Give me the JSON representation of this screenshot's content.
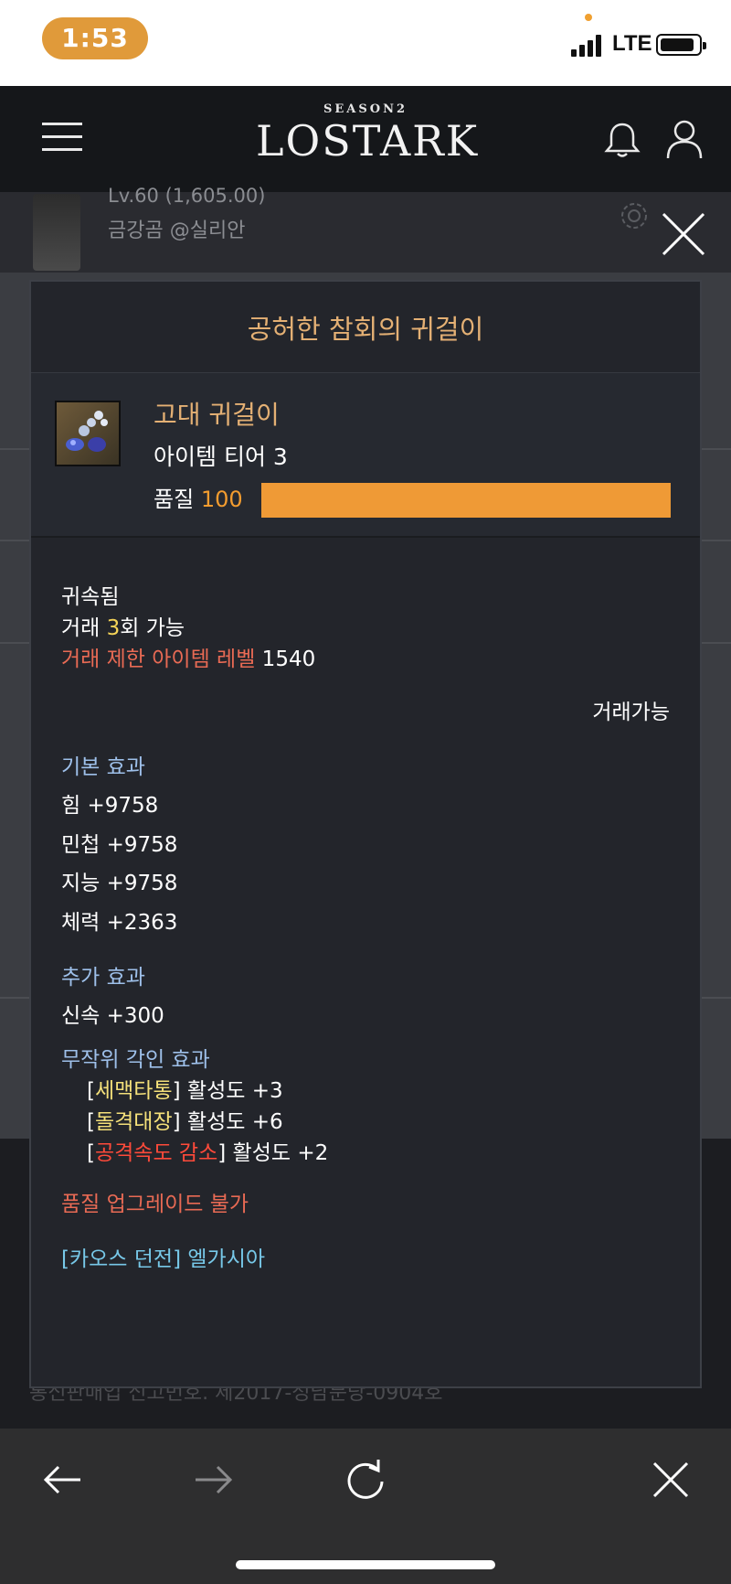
{
  "status_bar": {
    "time": "1:53",
    "network": "LTE"
  },
  "header": {
    "logo_season": "SEASON2",
    "logo_main": "LOSTARK"
  },
  "character": {
    "level": "Lv.60 (1,605.00)",
    "name": "금강곰 @실리안"
  },
  "footer": {
    "registration": "통신판매업 신고번호. 제2017-성남분당-0904호"
  },
  "tooltip": {
    "title": "공허한 참회의 귀걸이",
    "grade": "고대 귀걸이",
    "tier": "아이템 티어 3",
    "quality_label": "품질",
    "quality_value": "100",
    "quality_percent": 100,
    "bound": "귀속됨",
    "trade_prefix": "거래 ",
    "trade_count": "3",
    "trade_suffix": "회 가능",
    "trade_limit_label": "거래 제한 아이템 레벨",
    "trade_limit_value": " 1540",
    "tradeable": "거래가능",
    "basic_effect_title": "기본 효과",
    "basic_effects": [
      "힘 +9758",
      "민첩 +9758",
      "지능 +9758",
      "체력 +2363"
    ],
    "extra_effect_title": "추가 효과",
    "extra_effects": [
      "신속 +300"
    ],
    "engraving_title": "무작위 각인 효과",
    "engravings": [
      {
        "open": "[",
        "name": "세맥타통",
        "close": "]",
        "activity": " 활성도 +3"
      },
      {
        "open": "[",
        "name": "돌격대장",
        "close": "]",
        "activity": " 활성도 +6"
      },
      {
        "open": "[",
        "name": "공격속도 감소",
        "close": "]",
        "activity": " 활성도 +2"
      }
    ],
    "upgrade_note": "품질 업그레이드 불가",
    "source": "[카오스 던전] 엘가시아"
  },
  "colors": {
    "title_gold": "#e4b074",
    "quality_orange": "#ef9a36",
    "trade_count_yellow": "#f5d458",
    "limit_red": "#e86a54",
    "section_blue": "#9ec0ea",
    "source_cyan": "#77c8e8",
    "engraving_positive": "#f4e07a",
    "engraving_negative": "#ff4a3a"
  }
}
